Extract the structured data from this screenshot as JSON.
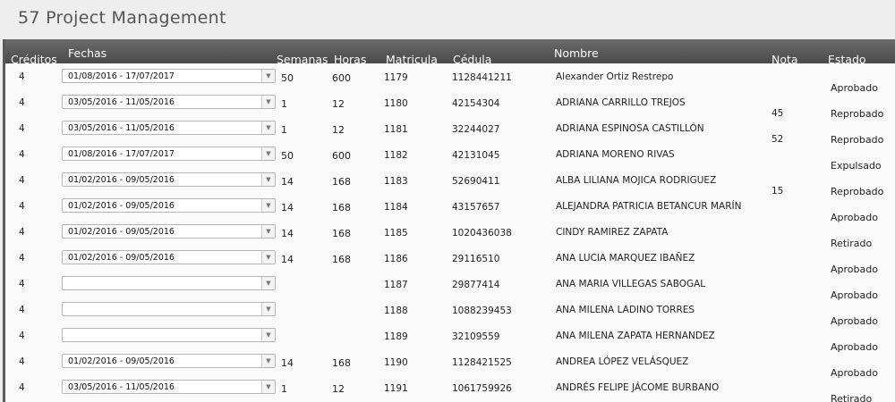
{
  "app": {
    "title": "57 Project Management"
  },
  "table": {
    "headers": {
      "creditos": "Créditos",
      "fechas": "Fechas",
      "semanas": "Semanas",
      "horas": "Horas",
      "matricula": "Matricula",
      "cedula": "Cédula",
      "nombre": "Nombre",
      "nota": "Nota",
      "estado": "Estado"
    },
    "rows": [
      {
        "creditos": "4",
        "fechas": "01/08/2016 - 17/07/2017",
        "semanas": "50",
        "horas": "600",
        "matricula": "1179",
        "cedula": "1128441211",
        "nombre": "Alexander  Ortiz Restrepo",
        "nota": "",
        "estado": "Aprobado"
      },
      {
        "creditos": "4",
        "fechas": "03/05/2016 - 11/05/2016",
        "semanas": "1",
        "horas": "12",
        "matricula": "1180",
        "cedula": "42154304",
        "nombre": "ADRIANA CARRILLO TREJOS",
        "nota": "45",
        "estado": "Reprobado"
      },
      {
        "creditos": "4",
        "fechas": "03/05/2016 - 11/05/2016",
        "semanas": "1",
        "horas": "12",
        "matricula": "1181",
        "cedula": "32244027",
        "nombre": "ADRIANA ESPINOSA CASTILLÓN",
        "nota": "52",
        "estado": "Reprobado"
      },
      {
        "creditos": "4",
        "fechas": "01/08/2016 - 17/07/2017",
        "semanas": "50",
        "horas": "600",
        "matricula": "1182",
        "cedula": "42131045",
        "nombre": "ADRIANA MORENO RIVAS",
        "nota": "",
        "estado": "Expulsado"
      },
      {
        "creditos": "4",
        "fechas": "01/02/2016 - 09/05/2016",
        "semanas": "14",
        "horas": "168",
        "matricula": "1183",
        "cedula": "52690411",
        "nombre": "ALBA LILIANA MOJICA RODRIGUEZ",
        "nota": "15",
        "estado": "Reprobado"
      },
      {
        "creditos": "4",
        "fechas": "01/02/2016 - 09/05/2016",
        "semanas": "14",
        "horas": "168",
        "matricula": "1184",
        "cedula": "43157657",
        "nombre": "ALEJANDRA PATRICIA BETANCUR MARÍN",
        "nota": "",
        "estado": "Aprobado"
      },
      {
        "creditos": "4",
        "fechas": "01/02/2016 - 09/05/2016",
        "semanas": "14",
        "horas": "168",
        "matricula": "1185",
        "cedula": "1020436038",
        "nombre": "CINDY RAMIREZ ZAPATA",
        "nota": "",
        "estado": "Retirado"
      },
      {
        "creditos": "4",
        "fechas": "01/02/2016 - 09/05/2016",
        "semanas": "14",
        "horas": "168",
        "matricula": "1186",
        "cedula": "29116510",
        "nombre": "ANA LUCIA MARQUEZ IBAÑEZ",
        "nota": "",
        "estado": "Aprobado"
      },
      {
        "creditos": "4",
        "fechas": "",
        "semanas": "",
        "horas": "",
        "matricula": "1187",
        "cedula": "29877414",
        "nombre": "ANA MARIA VILLEGAS SABOGAL",
        "nota": "",
        "estado": "Aprobado"
      },
      {
        "creditos": "4",
        "fechas": "",
        "semanas": "",
        "horas": "",
        "matricula": "1188",
        "cedula": "1088239453",
        "nombre": "ANA MILENA LADINO TORRES",
        "nota": "",
        "estado": "Aprobado"
      },
      {
        "creditos": "4",
        "fechas": "",
        "semanas": "",
        "horas": "",
        "matricula": "1189",
        "cedula": "32109559",
        "nombre": "ANA MILENA ZAPATA HERNANDEZ",
        "nota": "",
        "estado": "Aprobado"
      },
      {
        "creditos": "4",
        "fechas": "01/02/2016 - 09/05/2016",
        "semanas": "14",
        "horas": "168",
        "matricula": "1190",
        "cedula": "1128421525",
        "nombre": "ANDREA LÓPEZ VELÁSQUEZ",
        "nota": "",
        "estado": "Aprobado"
      },
      {
        "creditos": "4",
        "fechas": "03/05/2016 - 11/05/2016",
        "semanas": "1",
        "horas": "12",
        "matricula": "1191",
        "cedula": "1061759926",
        "nombre": "ANDRÉS FELIPE JÁCOME BURBANO",
        "nota": "",
        "estado": "Retirado"
      }
    ]
  },
  "icons": {
    "select_arrow": "chevron-down-icon"
  }
}
